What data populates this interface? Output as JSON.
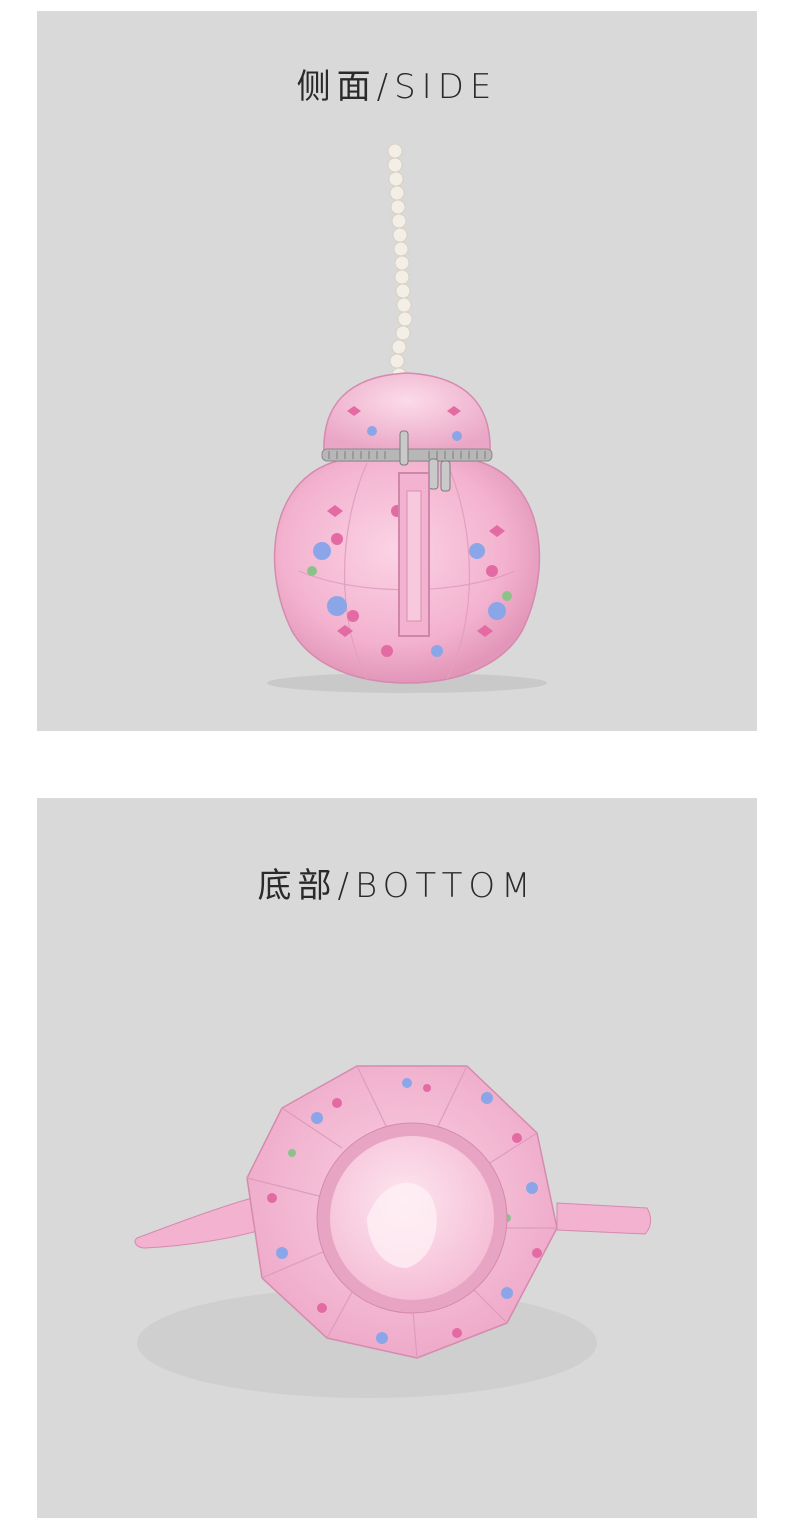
{
  "panels": [
    {
      "title": "侧面/SIDE"
    },
    {
      "title": "底部/BOTTOM"
    }
  ],
  "colors": {
    "panel_bg": "#d9d9d9",
    "bag_pink": "#f5b8d2",
    "bag_shadow": "#e79fc0",
    "pearl": "#f4efe6",
    "zipper": "#9a9a9a",
    "flower_blue": "#8aa6e8",
    "flower_pink": "#e46aa3",
    "leaf_green": "#8cc28a"
  }
}
